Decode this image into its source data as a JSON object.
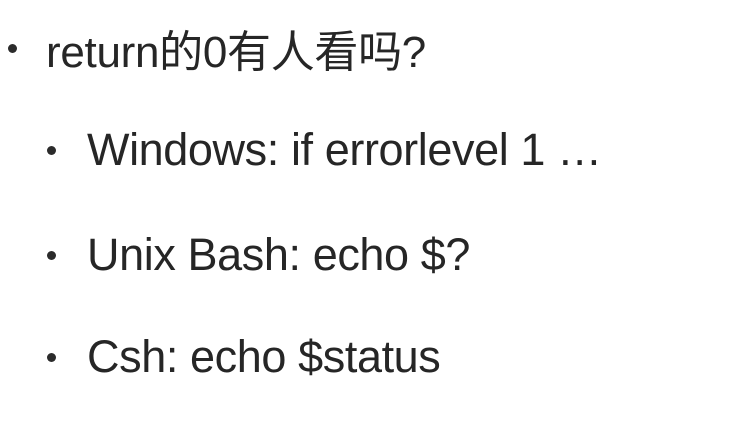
{
  "slide": {
    "title_bullet": "return的0有人看吗?",
    "sub_bullets": [
      {
        "text": "Windows:  if errorlevel 1 …"
      },
      {
        "text": "Unix Bash:  echo $?"
      },
      {
        "text": "Csh:  echo $status"
      }
    ]
  }
}
